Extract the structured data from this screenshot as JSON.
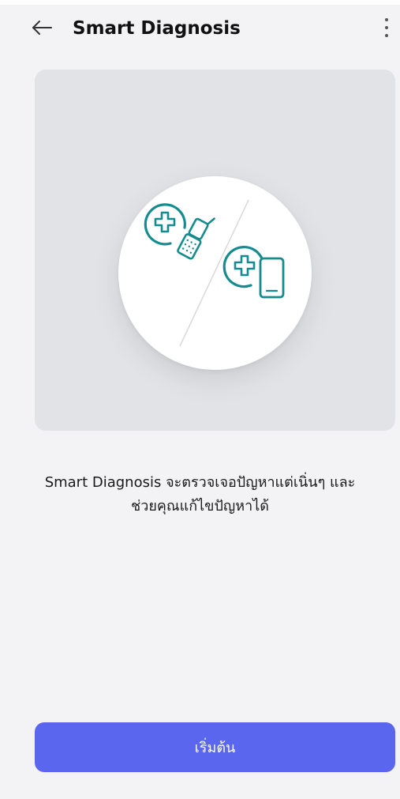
{
  "header": {
    "title": "Smart Diagnosis",
    "back_icon": "arrow-left-icon",
    "more_icon": "more-vertical-icon"
  },
  "hero": {
    "illustration_icons": [
      "medical-plus-flip-phone-icon",
      "medical-plus-smartphone-icon"
    ]
  },
  "description": {
    "line1": "Smart Diagnosis จะตรวจเจอปัญหาแต่เนิ่นๆ และ",
    "line2": "ช่วยคุณแก้ไขปัญหาได้"
  },
  "actions": {
    "start_label": "เริ่มต้น"
  },
  "colors": {
    "background": "#f3f3f6",
    "hero_card": "#e2e3e7",
    "teal_icon": "#138b8f",
    "primary_button": "#5b66ee"
  }
}
